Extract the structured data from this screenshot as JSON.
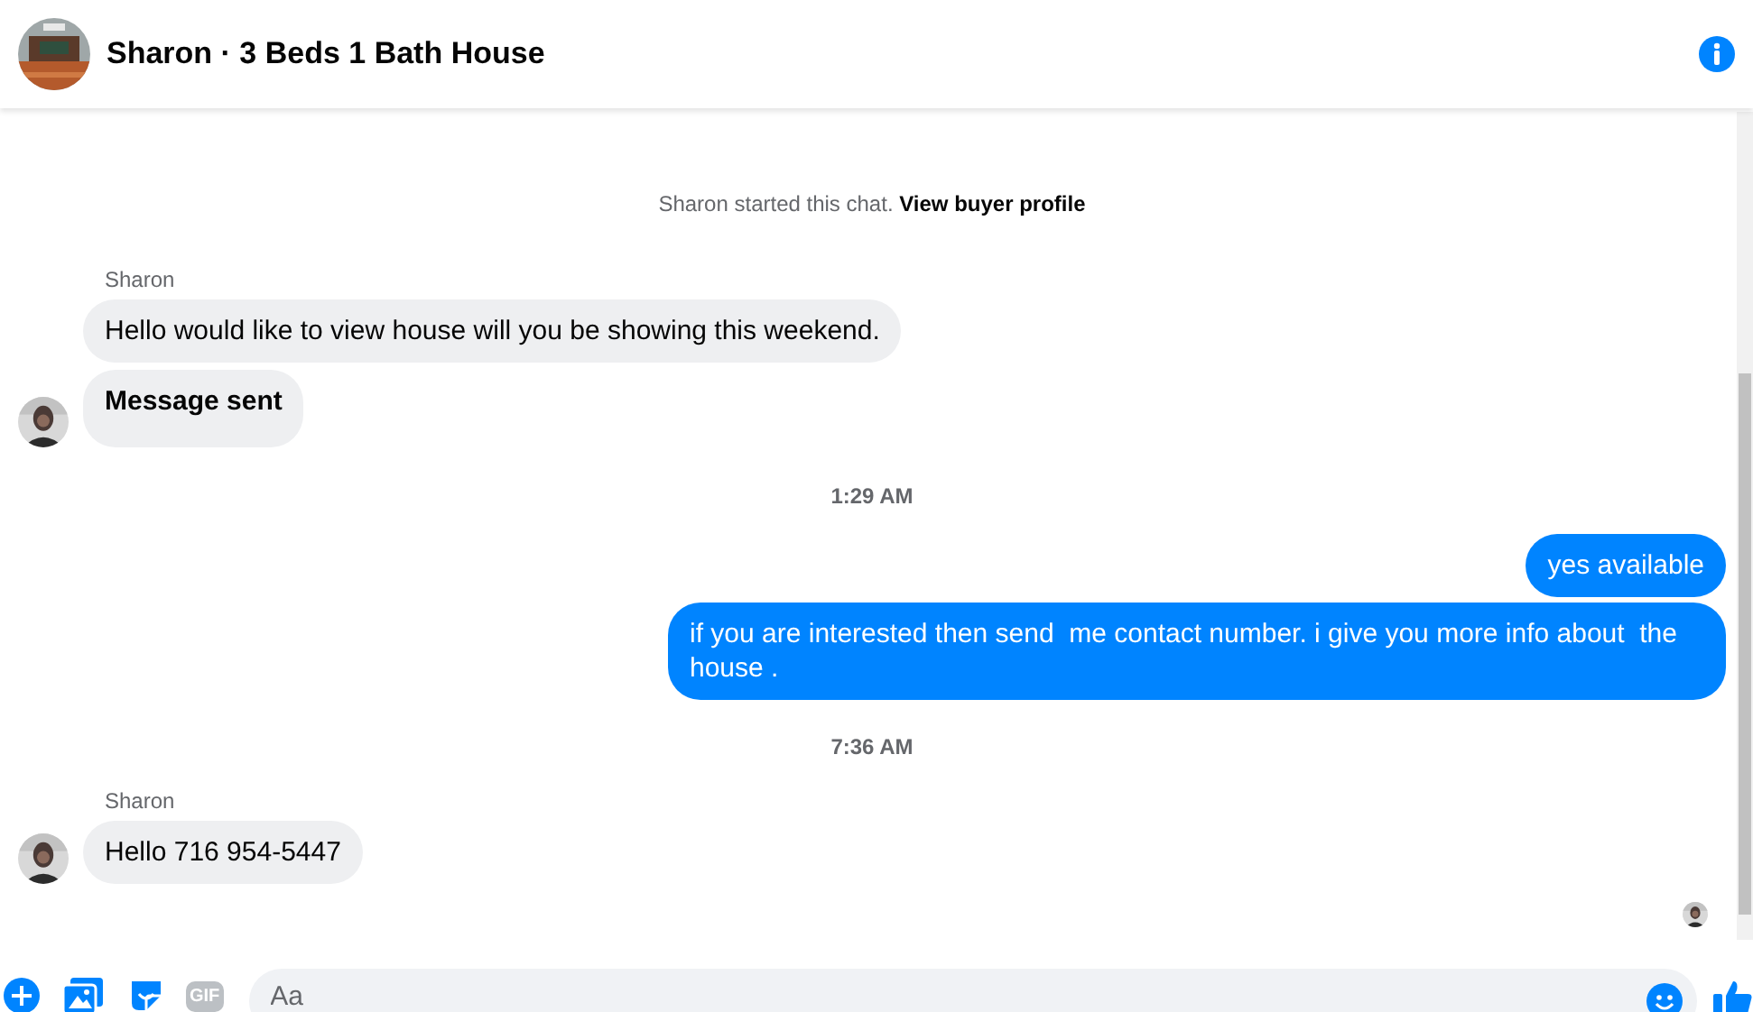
{
  "header": {
    "title": "Sharon · 3 Beds 1 Bath House"
  },
  "chat_start": {
    "text": "Sharon started this chat.",
    "link": "View buyer profile"
  },
  "messages": [
    {
      "kind": "sender",
      "text": "Sharon"
    },
    {
      "kind": "incoming",
      "text": "Hello would like to view house will you be showing this weekend.",
      "avatar": false,
      "bold": false
    },
    {
      "kind": "incoming",
      "text": "Message sent",
      "avatar": true,
      "bold": true
    },
    {
      "kind": "timestamp",
      "text": "1:29 AM"
    },
    {
      "kind": "outgoing",
      "text": "yes available"
    },
    {
      "kind": "outgoing",
      "text": "if you are interested then send  me contact number. i give you more info about  the house ."
    },
    {
      "kind": "timestamp",
      "text": "7:36 AM"
    },
    {
      "kind": "sender",
      "text": "Sharon"
    },
    {
      "kind": "incoming",
      "text": "Hello 716 954-5447",
      "avatar": true,
      "bold": false
    },
    {
      "kind": "seen"
    }
  ],
  "composer": {
    "gif_label": "GIF",
    "placeholder": "Aa"
  }
}
